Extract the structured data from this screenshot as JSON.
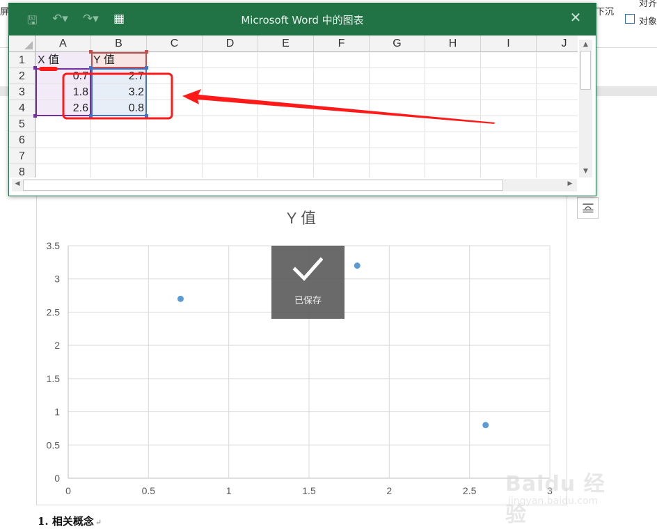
{
  "ribbon": {
    "left_fragment": "屏幕",
    "right_fragment_1": "下沉",
    "right_fragment_2": "对齐",
    "right_fragment_3": "对象"
  },
  "excel": {
    "window_title": "Microsoft Word 中的图表",
    "column_headers": [
      "A",
      "B",
      "C",
      "D",
      "E",
      "F",
      "G",
      "H",
      "I",
      "J"
    ],
    "row_headers": [
      "1",
      "2",
      "3",
      "4",
      "5",
      "6",
      "7",
      "8"
    ],
    "headers": {
      "x": "X 值",
      "y": "Y 值"
    },
    "rows": [
      {
        "x": "0.7",
        "y": "2.7"
      },
      {
        "x": "1.8",
        "y": "3.2"
      },
      {
        "x": "2.6",
        "y": "0.8"
      }
    ],
    "colors": {
      "title_bar": "#217346",
      "annotation_red": "#ff1a1a",
      "x_range": "#7030a0",
      "y_range": "#4472c4",
      "header_range": "#c0504d"
    }
  },
  "chart_data": {
    "type": "scatter",
    "title": "Y 值",
    "x": [
      0.7,
      1.8,
      2.6
    ],
    "y": [
      2.7,
      3.2,
      0.8
    ],
    "xlim": [
      0,
      3
    ],
    "ylim": [
      0,
      3.5
    ],
    "x_ticks": [
      "0",
      "0.5",
      "1",
      "1.5",
      "2",
      "2.5",
      "3"
    ],
    "y_ticks": [
      "0",
      "0.5",
      "1",
      "1.5",
      "2",
      "2.5",
      "3",
      "3.5"
    ],
    "grid": true,
    "marker_color": "#5b9bd5"
  },
  "toast": {
    "text": "已保存"
  },
  "document": {
    "heading": "1. 相关概念"
  },
  "watermark": {
    "top": "Baidu 经验",
    "bottom": "jingyan.baidu.com"
  }
}
